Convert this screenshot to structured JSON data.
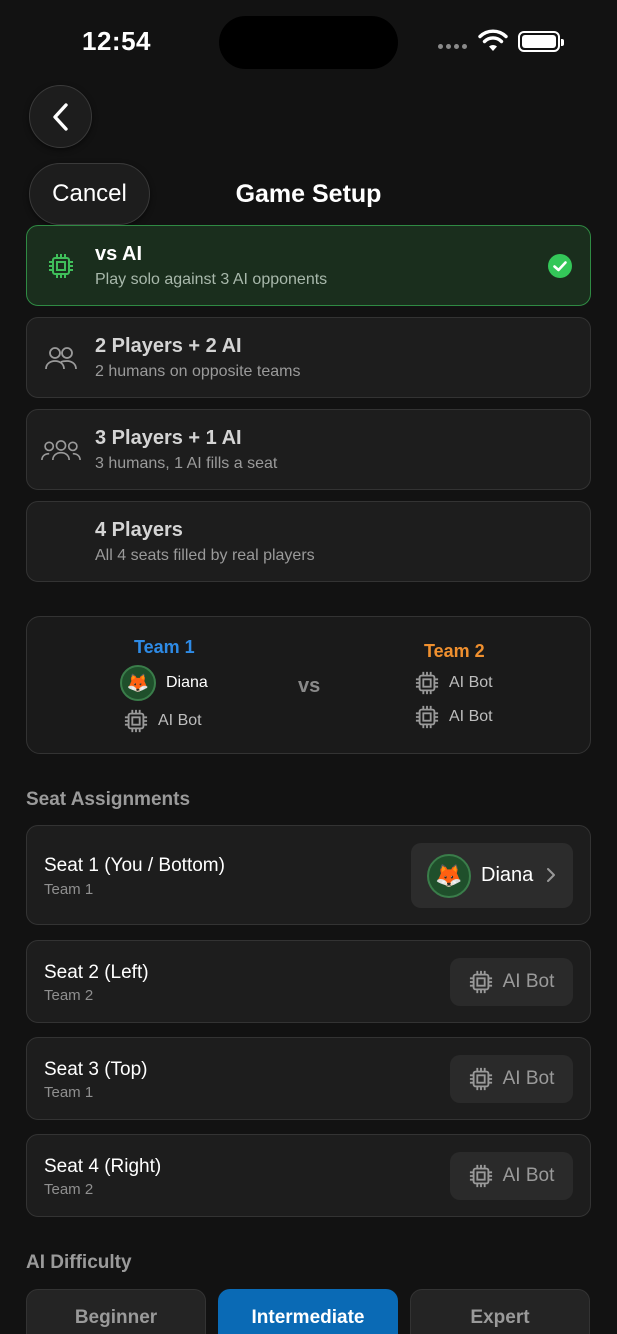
{
  "status": {
    "time": "12:54"
  },
  "nav": {
    "cancel_label": "Cancel",
    "title": "Game Setup"
  },
  "modes": [
    {
      "title": "vs AI",
      "subtitle": "Play solo against 3 AI opponents",
      "selected": true,
      "icon": "cpu-icon"
    },
    {
      "title": "2 Players + 2 AI",
      "subtitle": "2 humans on opposite teams",
      "selected": false,
      "icon": "two-users-icon"
    },
    {
      "title": "3 Players + 1 AI",
      "subtitle": "3 humans, 1 AI fills a seat",
      "selected": false,
      "icon": "three-users-icon"
    },
    {
      "title": "4 Players",
      "subtitle": "All 4 seats filled by real players",
      "selected": false,
      "icon": ""
    }
  ],
  "teams": {
    "team1": {
      "label": "Team 1",
      "members": [
        "Diana",
        "AI Bot"
      ]
    },
    "vs": "vs",
    "team2": {
      "label": "Team 2",
      "members": [
        "AI Bot",
        "AI Bot"
      ]
    }
  },
  "seat_section_label": "Seat Assignments",
  "seats": [
    {
      "title": "Seat 1 (You / Bottom)",
      "team": "Team 1",
      "occupant": "Diana"
    },
    {
      "title": "Seat 2 (Left)",
      "team": "Team 2",
      "occupant": "AI Bot"
    },
    {
      "title": "Seat 3 (Top)",
      "team": "Team 1",
      "occupant": "AI Bot"
    },
    {
      "title": "Seat 4 (Right)",
      "team": "Team 2",
      "occupant": "AI Bot"
    }
  ],
  "difficulty": {
    "label": "AI Difficulty",
    "options": [
      "Beginner",
      "Intermediate",
      "Expert"
    ],
    "selected": "Intermediate"
  },
  "colors": {
    "accent": "#0a6ab5",
    "selected_green": "#2f8a43",
    "team1": "#2e8be6",
    "team2": "#f0902f"
  },
  "avatar_glyph": "🦊"
}
